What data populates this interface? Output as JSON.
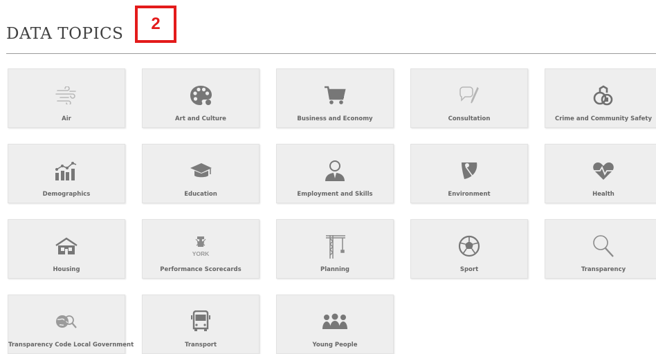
{
  "header": {
    "title": "DATA TOPICS",
    "badge": "2"
  },
  "topics": [
    {
      "label": "Air",
      "icon": "air-icon"
    },
    {
      "label": "Art and Culture",
      "icon": "palette-icon"
    },
    {
      "label": "Business and Economy",
      "icon": "shopping-cart-icon"
    },
    {
      "label": "Consultation",
      "icon": "speech-bubble-pen-icon"
    },
    {
      "label": "Crime and Community Safety",
      "icon": "handcuffs-icon"
    },
    {
      "label": "Demographics",
      "icon": "population-chart-icon"
    },
    {
      "label": "Education",
      "icon": "graduation-cap-icon"
    },
    {
      "label": "Employment and Skills",
      "icon": "businessman-icon"
    },
    {
      "label": "Environment",
      "icon": "leaf-icon"
    },
    {
      "label": "Health",
      "icon": "heartbeat-icon"
    },
    {
      "label": "Housing",
      "icon": "house-icon"
    },
    {
      "label": "Performance Scorecards",
      "icon": "york-crest-icon",
      "icon_text": "YORK"
    },
    {
      "label": "Planning",
      "icon": "crane-icon"
    },
    {
      "label": "Sport",
      "icon": "football-icon"
    },
    {
      "label": "Transparency",
      "icon": "magnifier-icon"
    },
    {
      "label": "Transparency Code Local Government",
      "icon": "globe-search-icon"
    },
    {
      "label": "Transport",
      "icon": "bus-icon"
    },
    {
      "label": "Young People",
      "icon": "people-group-icon"
    }
  ]
}
